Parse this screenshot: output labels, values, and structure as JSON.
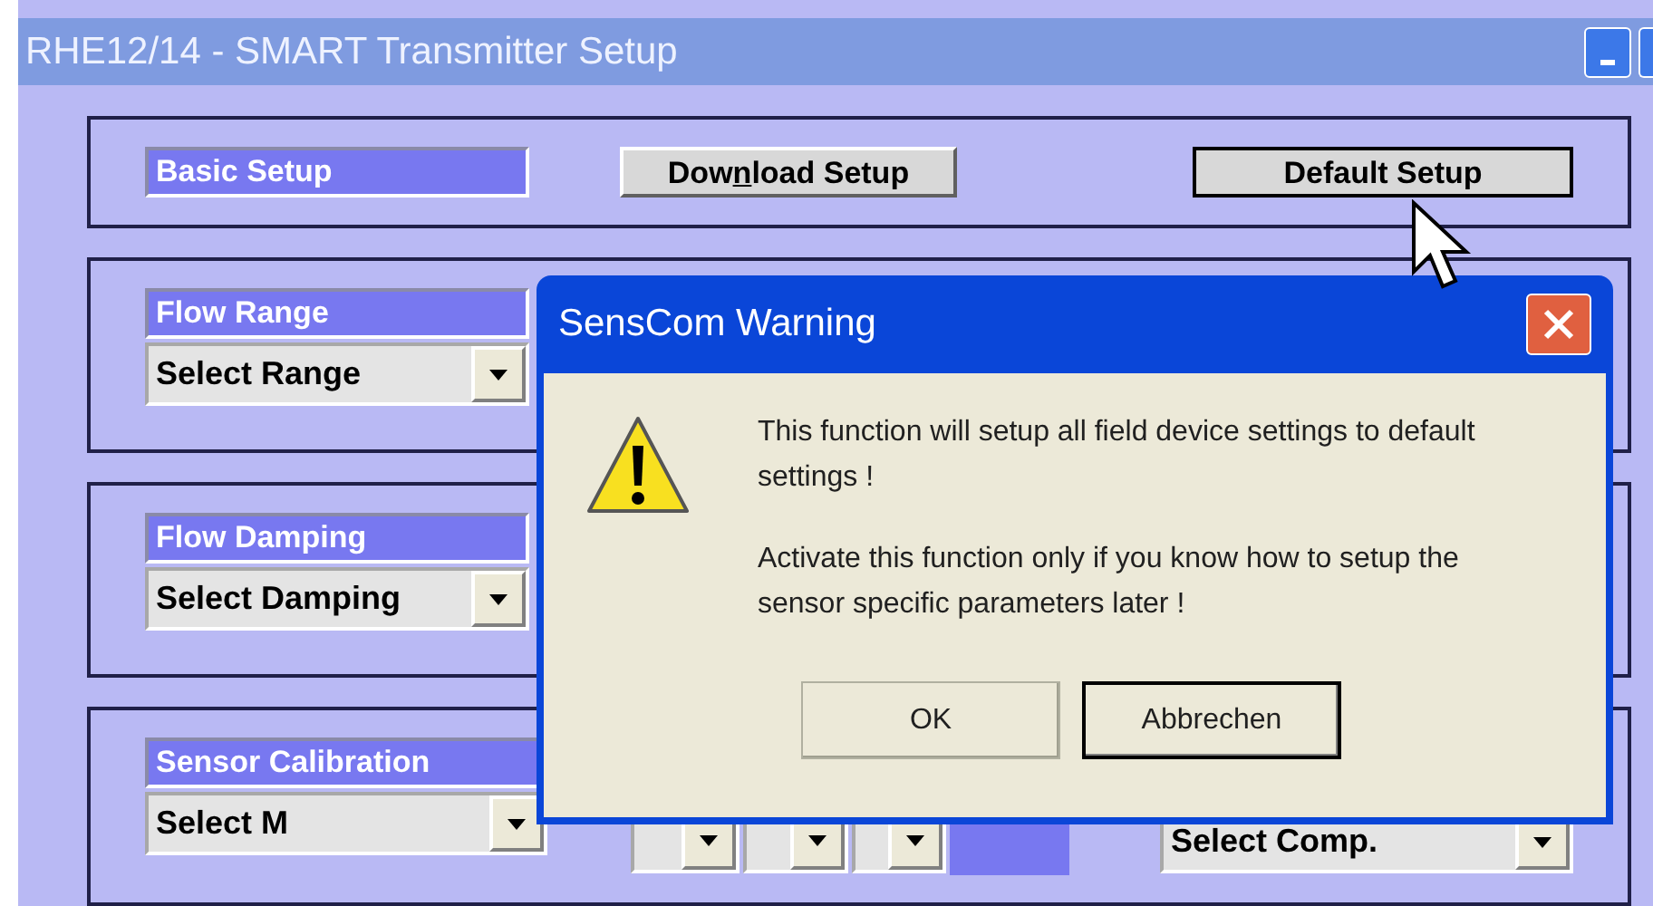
{
  "window": {
    "title": "RHE12/14 - SMART Transmitter Setup"
  },
  "basic_setup": {
    "label": "Basic Setup",
    "buttons": [
      {
        "kind": "mnemonic",
        "label_before": "Dow",
        "access_key": "n",
        "label_after": "load Setup"
      },
      {
        "kind": "plain",
        "label": "Default Setup"
      }
    ]
  },
  "sections": [
    {
      "kind": "single",
      "label": "Flow Range",
      "dropdown": "Select Range"
    },
    {
      "kind": "single",
      "label": "Flow Damping",
      "dropdown": "Select Damping"
    },
    {
      "kind": "calibration",
      "label": "Sensor Calibration",
      "dropdown": "Select M",
      "comp_dropdown": "Select Comp."
    }
  ],
  "dialog": {
    "title": "SensCom Warning",
    "messages": [
      "This function will setup all field device settings to default settings !",
      "Activate this function only if you know how to setup the sensor specific parameters later !"
    ],
    "buttons": [
      {
        "label": "OK",
        "focused": false
      },
      {
        "label": "Abbrechen",
        "focused": true
      }
    ]
  }
}
